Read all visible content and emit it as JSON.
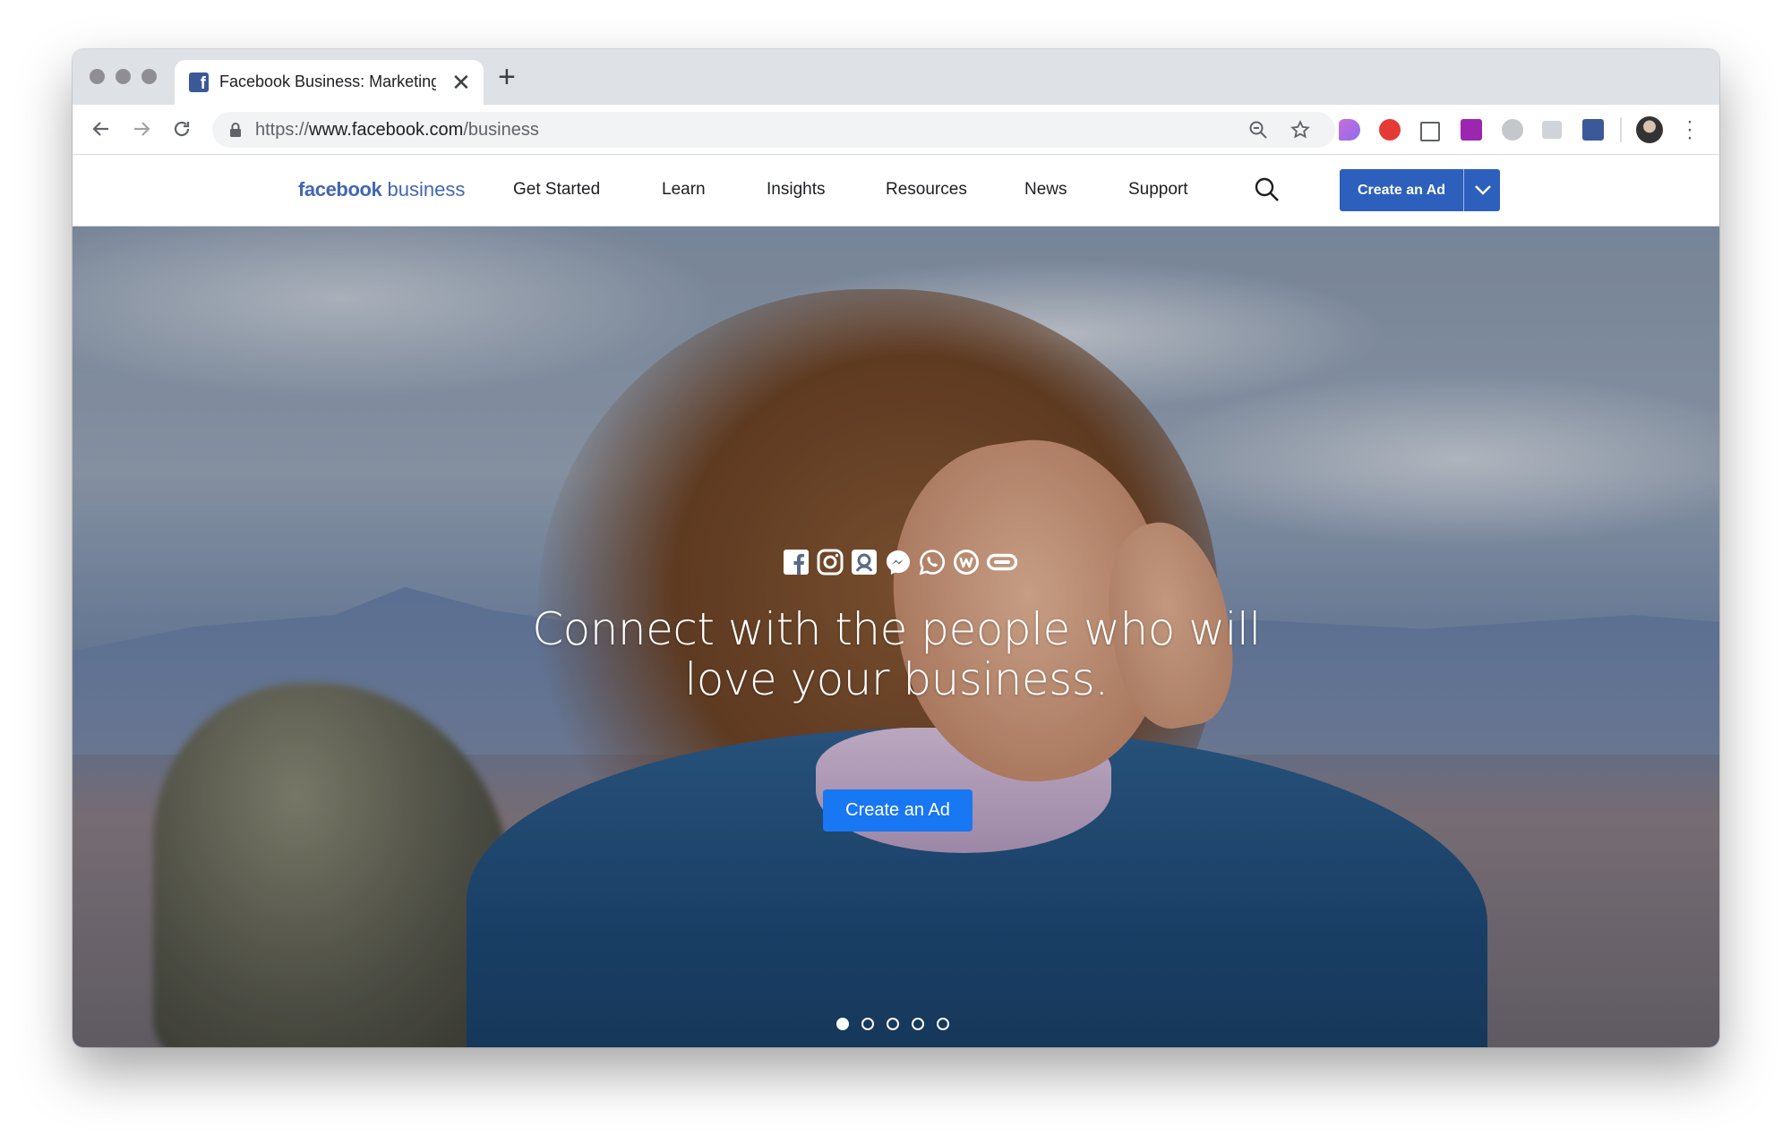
{
  "browser": {
    "tab": {
      "title": "Facebook Business: Marketing on Facebook",
      "favicon": "facebook-f-icon",
      "close_glyph": "✕"
    },
    "new_tab_glyph": "+",
    "address": {
      "scheme": "https://",
      "host": "www.facebook.com",
      "path": "/business"
    },
    "extensions": [
      "zoom-icon",
      "bookmark-star-icon",
      "extension-icon",
      "no-entry-extension-icon",
      "square-extension-icon",
      "rp-extension-icon",
      "messenger-extension-icon",
      "bi-extension-icon",
      "facebook-extension-icon"
    ]
  },
  "site": {
    "logo_bold": "facebook",
    "logo_light": "business",
    "nav": [
      "Get Started",
      "Learn",
      "Insights",
      "Resources",
      "News",
      "Support"
    ],
    "cta_label": "Create an Ad",
    "accent": "#2d5fbd"
  },
  "hero": {
    "social_icons": [
      "facebook-icon",
      "instagram-icon",
      "audience-network-icon",
      "messenger-icon",
      "whatsapp-icon",
      "workplace-icon",
      "oculus-icon"
    ],
    "title": "Connect with the people who will love your business.",
    "button_label": "Create an Ad",
    "button_color": "#1877f2",
    "slides_total": 5,
    "active_slide": 1
  }
}
